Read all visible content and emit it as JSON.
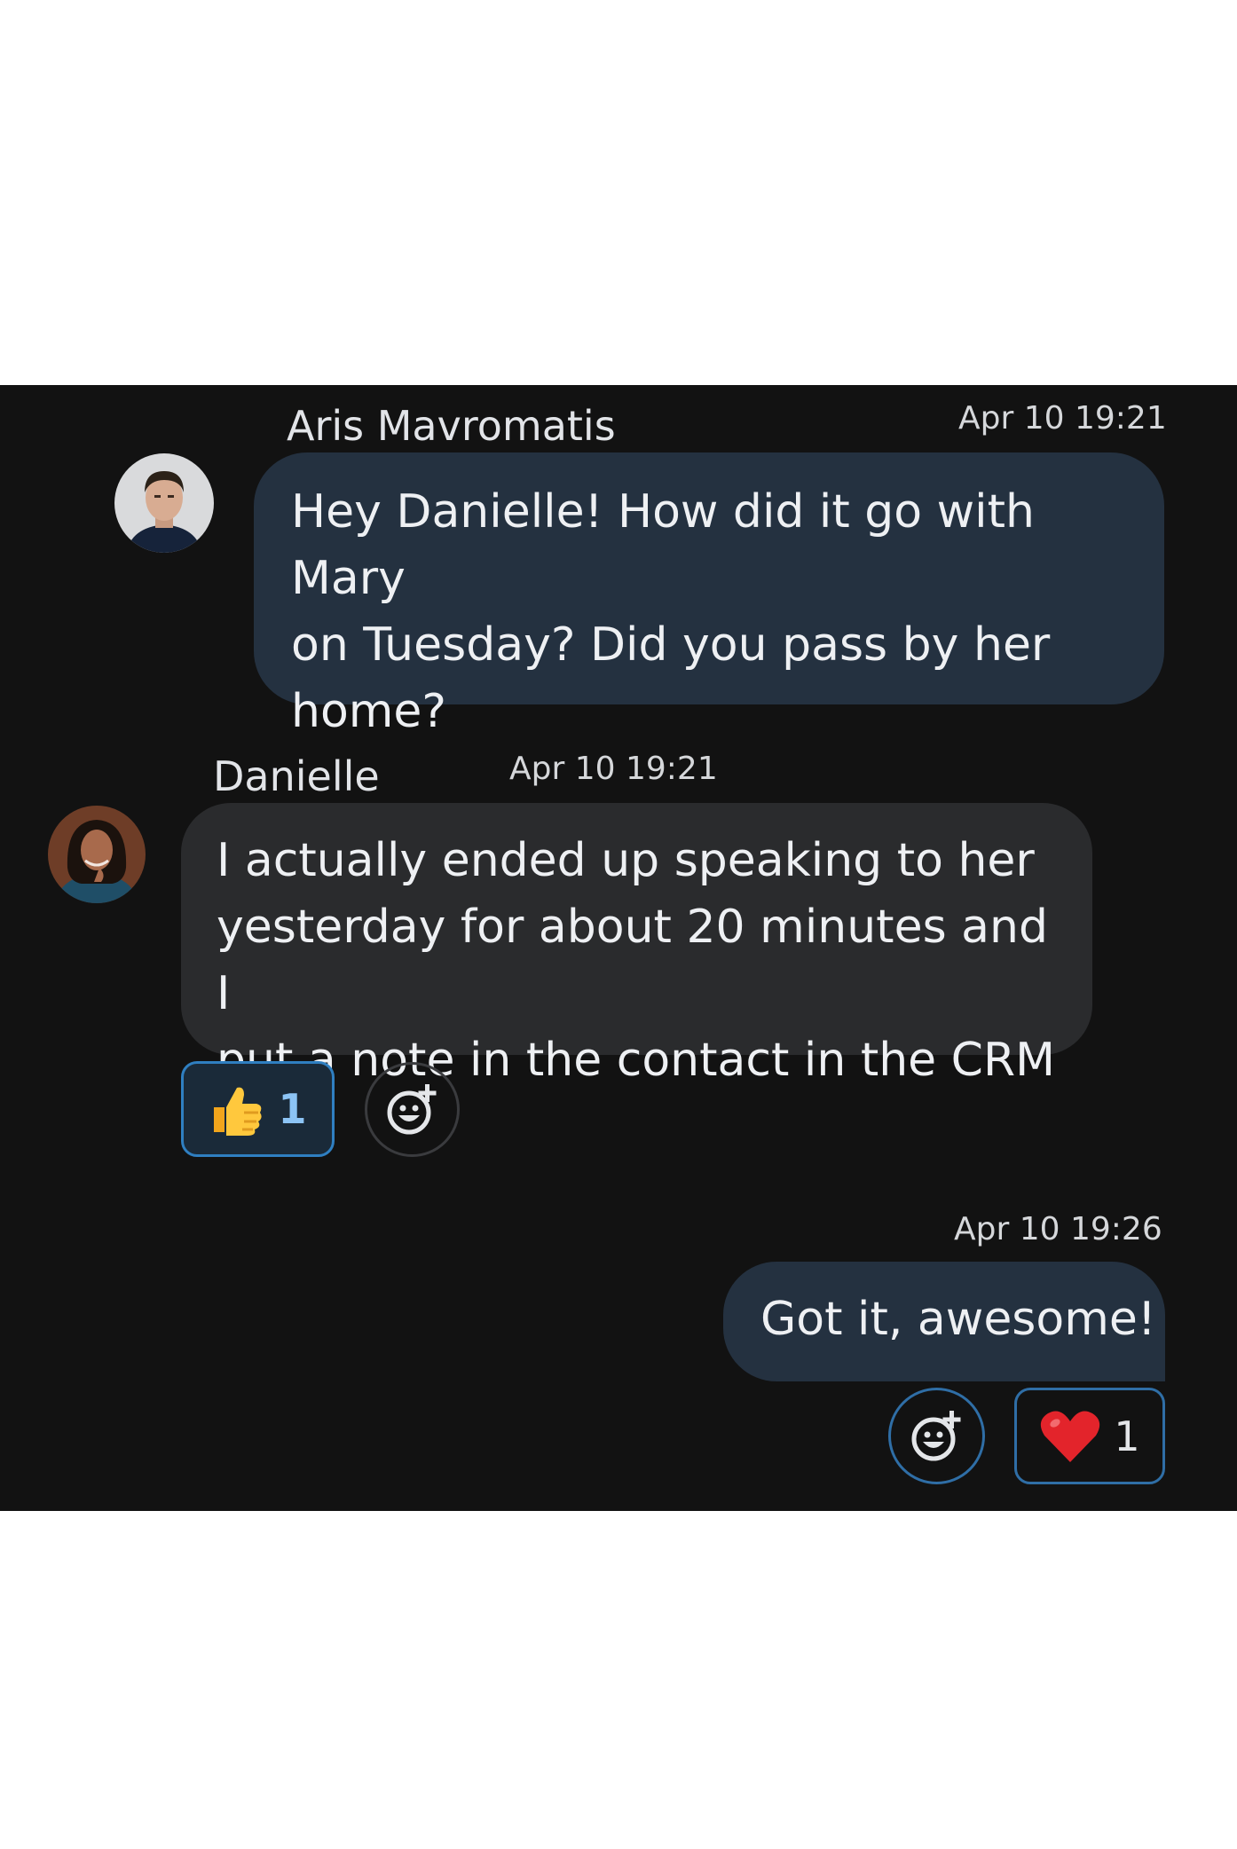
{
  "messages": [
    {
      "sender": "Aris Mavromatis",
      "timestamp": "Apr 10 19:21",
      "text": "Hey Danielle! How did it go with Mary\non Tuesday? Did you pass by her\nhome?",
      "avatar": "man-avatar"
    },
    {
      "sender": "Danielle",
      "timestamp": "Apr 10 19:21",
      "text": "I actually ended up speaking to her\nyesterday for about 20 minutes and I\nput a note in the contact in the CRM",
      "avatar": "woman-avatar",
      "reactions": [
        {
          "icon": "thumbs-up-emoji",
          "count": "1",
          "selected": true
        }
      ]
    },
    {
      "sender": "",
      "timestamp": "Apr 10 19:26",
      "text": "Got it, awesome!",
      "reactions": [
        {
          "icon": "heart-emoji",
          "count": "1",
          "selected": false
        }
      ]
    }
  ],
  "colors": {
    "panel_background": "#121212",
    "own_bubble": "#243140",
    "other_bubble": "#2a2b2d",
    "selected_reaction_border": "#2f7fc1",
    "selected_reaction_fill": "#1a2a39",
    "reaction_count_selected": "#8cc4f5"
  }
}
